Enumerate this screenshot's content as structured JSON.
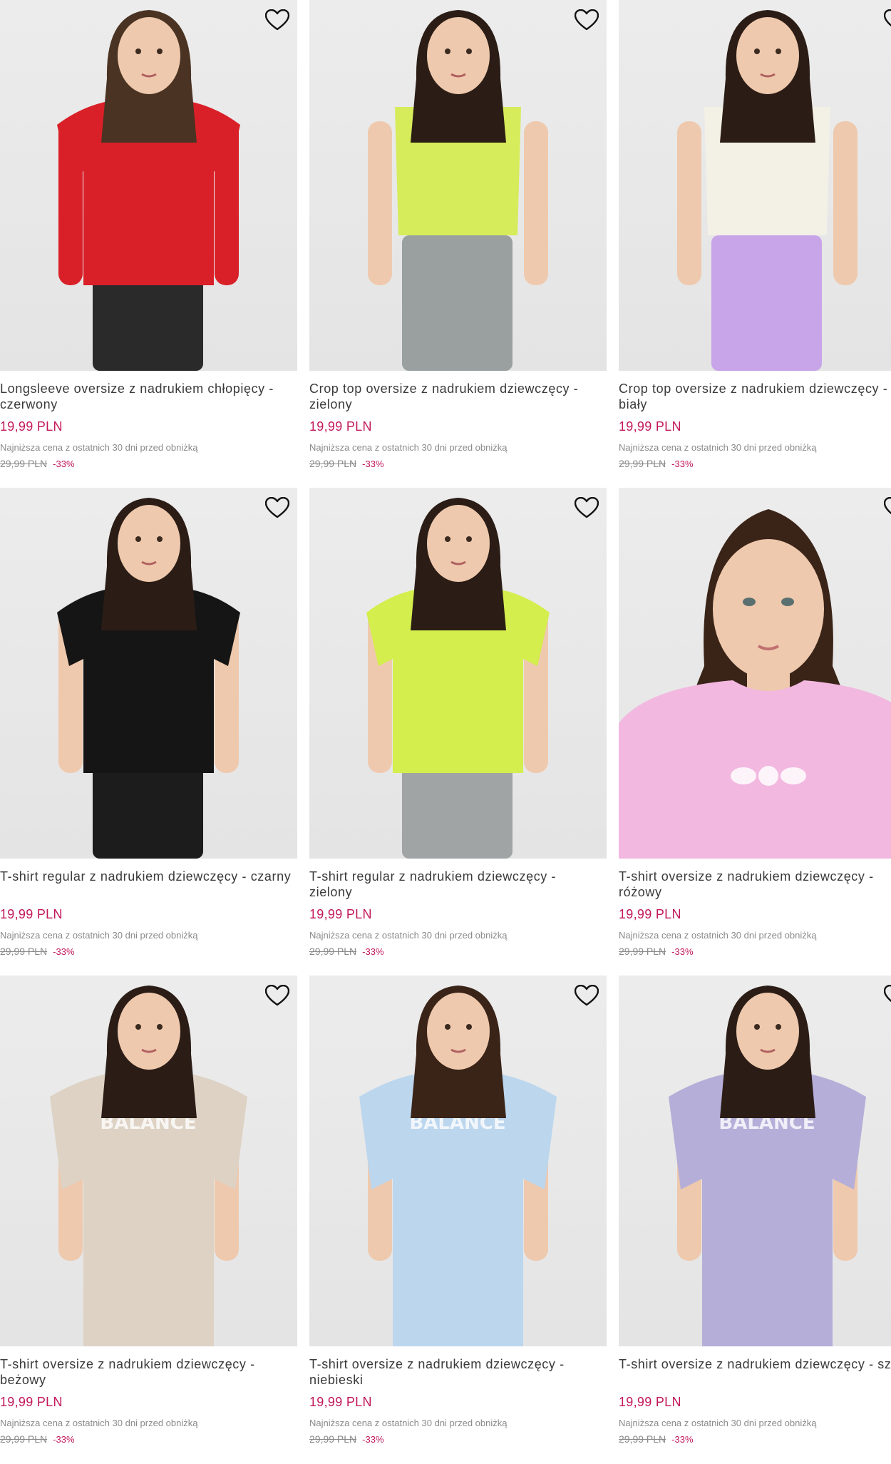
{
  "colors": {
    "price": "#c2185b",
    "muted": "#8a8a8a",
    "text": "#3a3a3a",
    "photo_bg": "#e8e8e8"
  },
  "icons": {
    "favorite": "heart-outline-icon"
  },
  "products": [
    {
      "title": "Longsleeve oversize z nadrukiem chłopięcy - czerwony",
      "price": "19,99 PLN",
      "lowest_note": "Najniższa cena z ostatnich 30 dni przed obniżką",
      "old_price": "29,99 PLN",
      "discount": "-33%",
      "garment_color": "#d92028",
      "bottom_color": "#2a2a2a",
      "hair_color": "#4a3322",
      "style": "longsleeve"
    },
    {
      "title": "Crop top oversize z nadrukiem dziewczęcy - zielony",
      "price": "19,99 PLN",
      "lowest_note": "Najniższa cena z ostatnich 30 dni przed obniżką",
      "old_price": "29,99 PLN",
      "discount": "-33%",
      "garment_color": "#d6ec5a",
      "bottom_color": "#9aa0a0",
      "hair_color": "#2b1d16",
      "style": "crop"
    },
    {
      "title": "Crop top oversize z nadrukiem dziewczęcy - biały",
      "price": "19,99 PLN",
      "lowest_note": "Najniższa cena z ostatnich 30 dni przed obniżką",
      "old_price": "29,99 PLN",
      "discount": "-33%",
      "garment_color": "#f3f0e6",
      "bottom_color": "#c8a4e8",
      "hair_color": "#2b1d16",
      "style": "crop"
    },
    {
      "title": "T-shirt regular z nadrukiem dziewczęcy - czarny",
      "price": "19,99 PLN",
      "lowest_note": "Najniższa cena z ostatnich 30 dni przed obniżką",
      "old_price": "29,99 PLN",
      "discount": "-33%",
      "garment_color": "#151515",
      "bottom_color": "#1c1c1c",
      "hair_color": "#2b1d16",
      "style": "tee"
    },
    {
      "title": "T-shirt regular z nadrukiem dziewczęcy - zielony",
      "price": "19,99 PLN",
      "lowest_note": "Najniższa cena z ostatnich 30 dni przed obniżką",
      "old_price": "29,99 PLN",
      "discount": "-33%",
      "garment_color": "#d4ee4e",
      "bottom_color": "#a0a4a4",
      "hair_color": "#2b1d16",
      "style": "tee"
    },
    {
      "title": "T-shirt oversize z nadrukiem dziewczęcy - różowy",
      "price": "19,99 PLN",
      "lowest_note": "Najniższa cena z ostatnich 30 dni przed obniżką",
      "old_price": "29,99 PLN",
      "discount": "-33%",
      "garment_color": "#f2b8e0",
      "bottom_color": "#f2b8e0",
      "hair_color": "#3a2418",
      "style": "closeup"
    },
    {
      "title": "T-shirt oversize z nadrukiem dziewczęcy - beżowy",
      "price": "19,99 PLN",
      "lowest_note": "Najniższa cena z ostatnich 30 dni przed obniżką",
      "old_price": "29,99 PLN",
      "discount": "-33%",
      "garment_color": "#ddd2c4",
      "bottom_color": "#ddd2c4",
      "hair_color": "#2b1d16",
      "style": "oversize"
    },
    {
      "title": "T-shirt oversize z nadrukiem dziewczęcy - niebieski",
      "price": "19,99 PLN",
      "lowest_note": "Najniższa cena z ostatnich 30 dni przed obniżką",
      "old_price": "29,99 PLN",
      "discount": "-33%",
      "garment_color": "#bcd6ee",
      "bottom_color": "#bcd6ee",
      "hair_color": "#3a2418",
      "style": "oversize"
    },
    {
      "title": "T-shirt oversize z nadrukiem dziewczęcy - szary",
      "price": "19,99 PLN",
      "lowest_note": "Najniższa cena z ostatnich 30 dni przed obniżką",
      "old_price": "29,99 PLN",
      "discount": "-33%",
      "garment_color": "#b4aed8",
      "bottom_color": "#b4aed8",
      "hair_color": "#2b1d16",
      "style": "oversize"
    }
  ]
}
